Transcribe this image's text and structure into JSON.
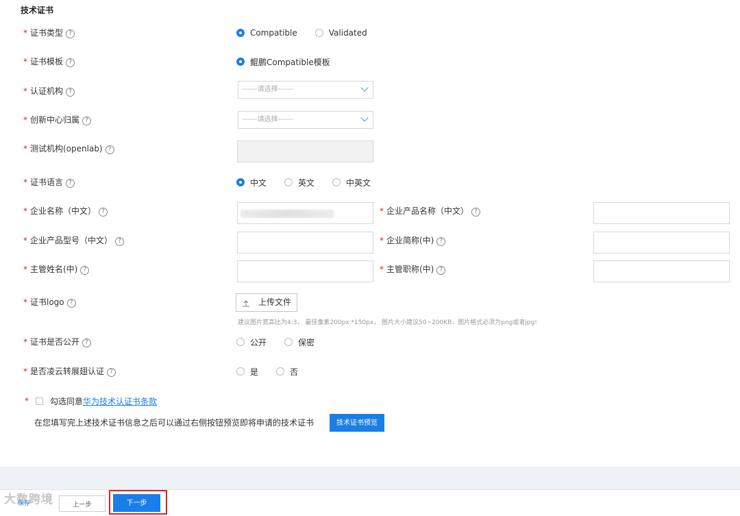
{
  "section_title": "技术证书",
  "help_glyph": "?",
  "required_mark": "*",
  "fields": {
    "cert_type": {
      "label": "证书类型",
      "options": [
        "Compatible",
        "Validated"
      ],
      "selected": "Compatible"
    },
    "cert_template": {
      "label": "证书模板",
      "options": [
        "鲲鹏Compatible模板"
      ],
      "selected": "鲲鹏Compatible模板"
    },
    "auth_org": {
      "label": "认证机构",
      "placeholder": "------请选择------"
    },
    "innovation_center": {
      "label": "创新中心归属",
      "placeholder": "------请选择------"
    },
    "test_org": {
      "label": "测试机构(openlab)",
      "value": ""
    },
    "cert_language": {
      "label": "证书语言",
      "options": [
        "中文",
        "英文",
        "中英文"
      ],
      "selected": "中文"
    },
    "company_name_cn": {
      "label": "企业名称（中文）",
      "value": ""
    },
    "product_name_cn": {
      "label": "企业产品名称（中文）",
      "value": ""
    },
    "product_model_cn": {
      "label": "企业产品型号（中文）",
      "value": ""
    },
    "company_short_cn": {
      "label": "企业简称(中)",
      "value": ""
    },
    "manager_name_cn": {
      "label": "主管姓名(中)",
      "value": ""
    },
    "manager_title_cn": {
      "label": "主管职称(中)",
      "value": ""
    },
    "cert_logo": {
      "label": "证书logo",
      "upload_label": "上传文件",
      "upload_icon": "upload-icon",
      "hint": "建议图片宽高比为4:3， 最佳像素200px *150px， 图片大小建议50~200KB，图片格式必须为png或者jpg!"
    },
    "cert_public": {
      "label": "证书是否公开",
      "options": [
        "公开",
        "保密"
      ],
      "selected": null
    },
    "lingyun": {
      "label": "是否凌云转展翅认证",
      "options": [
        "是",
        "否"
      ],
      "selected": null
    }
  },
  "agreement": {
    "prefix": "勾选同意",
    "link": "华为技术认证书条款",
    "checked": false
  },
  "preview_note": "在您填写完上述技术证书信息之后可以通过右侧按钮预览即将申请的技术证书",
  "preview_button": "技术证书预览",
  "footer": {
    "save": "保存",
    "prev": "上一步",
    "next": "下一步"
  },
  "watermark": "大数跨境",
  "colors": {
    "accent": "#1a7ee8",
    "required": "#e02020",
    "highlight": "#e02020"
  }
}
